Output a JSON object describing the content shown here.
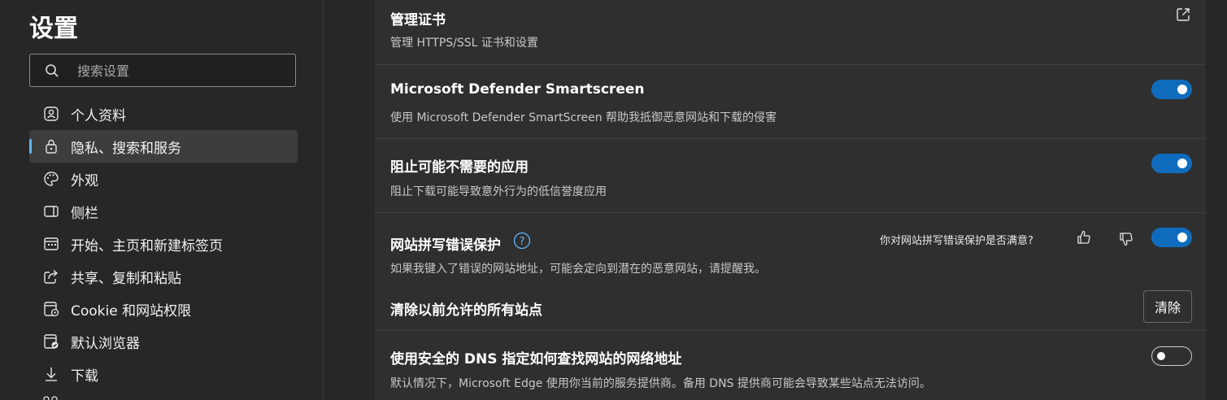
{
  "sidebar": {
    "title": "设置",
    "search_placeholder": "搜索设置",
    "items": [
      {
        "label": "个人资料",
        "icon": "profile-icon"
      },
      {
        "label": "隐私、搜索和服务",
        "icon": "lock-icon",
        "active": true
      },
      {
        "label": "外观",
        "icon": "palette-icon"
      },
      {
        "label": "侧栏",
        "icon": "sidebar-icon"
      },
      {
        "label": "开始、主页和新建标签页",
        "icon": "home-page-icon"
      },
      {
        "label": "共享、复制和粘贴",
        "icon": "share-icon"
      },
      {
        "label": "Cookie 和网站权限",
        "icon": "cookie-permissions-icon"
      },
      {
        "label": "默认浏览器",
        "icon": "default-browser-icon"
      },
      {
        "label": "下载",
        "icon": "download-icon"
      }
    ]
  },
  "main": {
    "certs": {
      "title": "管理证书",
      "desc": "管理 HTTPS/SSL 证书和设置"
    },
    "smartscreen": {
      "title": "Microsoft Defender Smartscreen",
      "desc": "使用 Microsoft Defender SmartScreen 帮助我抵御恶意网站和下载的侵害",
      "on": true
    },
    "pua": {
      "title": "阻止可能不需要的应用",
      "desc": "阻止下载可能导致意外行为的低信誉度应用",
      "on": true
    },
    "typo": {
      "title": "网站拼写错误保护",
      "desc": "如果我键入了错误的网站地址，可能会定向到潜在的恶意网站，请提醒我。",
      "feedback": "你对网站拼写错误保护是否满意?",
      "on": true
    },
    "clear": {
      "title": "清除以前允许的所有站点",
      "button": "清除"
    },
    "dns": {
      "title": "使用安全的 DNS 指定如何查找网站的网络地址",
      "desc": "默认情况下，Microsoft Edge 使用你当前的服务提供商。备用 DNS 提供商可能会导致某些站点无法访问。",
      "on": false
    }
  },
  "colors": {
    "accent": "#0f6cbd",
    "active_bar": "#60b6ff"
  }
}
